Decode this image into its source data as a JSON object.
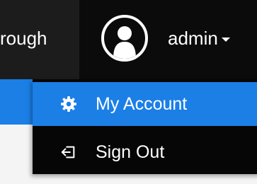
{
  "navbar": {
    "left_partial_label": "rough",
    "user": {
      "avatar_icon": "user-avatar-icon",
      "username": "admin",
      "toggle_icon": "caret-down-icon"
    }
  },
  "dropdown": {
    "items": [
      {
        "label": "My Account",
        "icon": "gear-icon",
        "active": true
      },
      {
        "label": "Sign Out",
        "icon": "sign-out-icon",
        "active": false
      }
    ]
  },
  "colors": {
    "navbar_bg": "#0b0b0b",
    "accent_blue": "#1b7fe6",
    "menu_bg": "#060606",
    "text": "#ffffff"
  }
}
